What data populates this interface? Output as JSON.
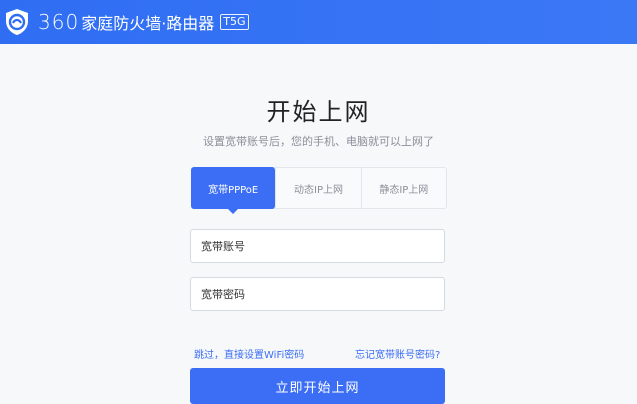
{
  "header": {
    "brand_number": "360",
    "brand_name": "家庭防火墙·路由器",
    "model": "T5G",
    "logo_icon": "shield-logo-icon",
    "background": "#3b78f6"
  },
  "main": {
    "title": "开始上网",
    "subtitle": "设置宽带账号后，您的手机、电脑就可以上网了"
  },
  "tabs": [
    {
      "label": "宽带PPPoE",
      "active": true
    },
    {
      "label": "动态IP上网",
      "active": false
    },
    {
      "label": "静态IP上网",
      "active": false
    }
  ],
  "form": {
    "account_placeholder": "宽带账号",
    "password_placeholder": "宽带密码",
    "account_value": "",
    "password_value": ""
  },
  "links": {
    "skip": "跳过，直接设置WiFi密码",
    "forgot": "忘记宽带账号密码?"
  },
  "submit_label": "立即开始上网",
  "colors": {
    "accent": "#3b6ef5",
    "border": "#d6dae0",
    "muted_text": "#8a8f99"
  }
}
